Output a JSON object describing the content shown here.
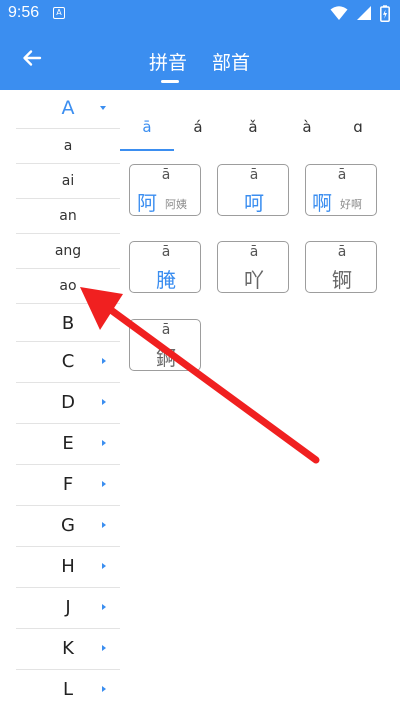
{
  "status": {
    "time": "9:56",
    "notif_letter": "A"
  },
  "appbar": {
    "tabs": [
      {
        "label": "拼音",
        "active": true
      },
      {
        "label": "部首",
        "active": false
      }
    ]
  },
  "letters": {
    "expanded": "A",
    "syllables": [
      "a",
      "ai",
      "an",
      "ang",
      "ao"
    ],
    "others": [
      "B",
      "C",
      "D",
      "E",
      "F",
      "G",
      "H",
      "J",
      "K",
      "L"
    ]
  },
  "tones": [
    {
      "label": "ā",
      "active": true
    },
    {
      "label": "á",
      "active": false
    },
    {
      "label": "ǎ",
      "active": false
    },
    {
      "label": "à",
      "active": false
    },
    {
      "label": "ɑ",
      "active": false
    }
  ],
  "chars": [
    {
      "pinyin": "ā",
      "char": "阿",
      "example": "阿姨",
      "color": "blue"
    },
    {
      "pinyin": "ā",
      "char": "呵",
      "example": "",
      "color": "blue"
    },
    {
      "pinyin": "ā",
      "char": "啊",
      "example": "好啊",
      "color": "blue"
    },
    {
      "pinyin": "ā",
      "char": "腌",
      "example": "",
      "color": "blue"
    },
    {
      "pinyin": "ā",
      "char": "吖",
      "example": "",
      "color": "gray"
    },
    {
      "pinyin": "ā",
      "char": "锕",
      "example": "",
      "color": "gray"
    },
    {
      "pinyin": "ā",
      "char": "錒",
      "example": "",
      "color": "gray"
    }
  ],
  "colors": {
    "accent": "#3b8ef0",
    "arrow": "#f02020"
  }
}
